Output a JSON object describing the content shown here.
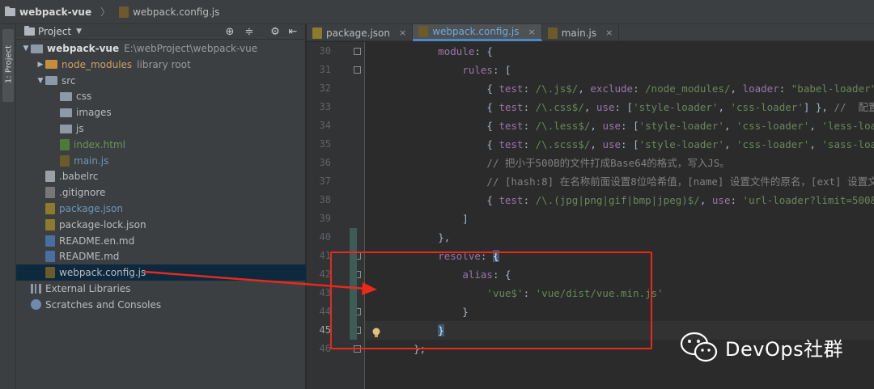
{
  "breadcrumb": {
    "project": "webpack-vue",
    "file": "webpack.config.js"
  },
  "strip": {
    "label": "1: Project"
  },
  "project_panel": {
    "title": "Project",
    "tree": [
      {
        "label": "webpack-vue",
        "extra": "E:\\webProject\\webpack-vue",
        "icon": "folder-icon"
      },
      {
        "label": "node_modules",
        "extra": "library root",
        "icon": "folder-icon"
      },
      {
        "label": "src",
        "icon": "folder-icon"
      },
      {
        "label": "css",
        "icon": "folder-icon"
      },
      {
        "label": "images",
        "icon": "folder-icon"
      },
      {
        "label": "js",
        "icon": "folder-icon"
      },
      {
        "label": "index.html",
        "icon": "html-file-icon"
      },
      {
        "label": "main.js",
        "icon": "js-file-icon"
      },
      {
        "label": ".babelrc",
        "icon": "file-icon"
      },
      {
        "label": ".gitignore",
        "icon": "file-icon"
      },
      {
        "label": "package.json",
        "icon": "json-file-icon"
      },
      {
        "label": "package-lock.json",
        "icon": "json-file-icon"
      },
      {
        "label": "README.en.md",
        "icon": "md-file-icon"
      },
      {
        "label": "README.md",
        "icon": "md-file-icon"
      },
      {
        "label": "webpack.config.js",
        "icon": "js-file-icon"
      },
      {
        "label": "External Libraries",
        "icon": "libraries-icon"
      },
      {
        "label": "Scratches and Consoles",
        "icon": "scratches-icon"
      }
    ]
  },
  "tabs": [
    {
      "label": "package.json",
      "active": false
    },
    {
      "label": "webpack.config.js",
      "active": true
    },
    {
      "label": "main.js",
      "active": false
    }
  ],
  "tab_close": "×",
  "editor": {
    "line_numbers": [
      "30",
      "31",
      "32",
      "33",
      "34",
      "35",
      "36",
      "37",
      "38",
      "39",
      "40",
      "41",
      "42",
      "43",
      "44",
      "45",
      "46"
    ],
    "current_line": "45"
  },
  "watermark": {
    "text": "DevOps社群"
  },
  "colors": {
    "keyword": "#9876aa",
    "string": "#6a8759",
    "comment": "#808080",
    "annotation_red": "#e8291c",
    "tab_active": "#4a88c7"
  }
}
